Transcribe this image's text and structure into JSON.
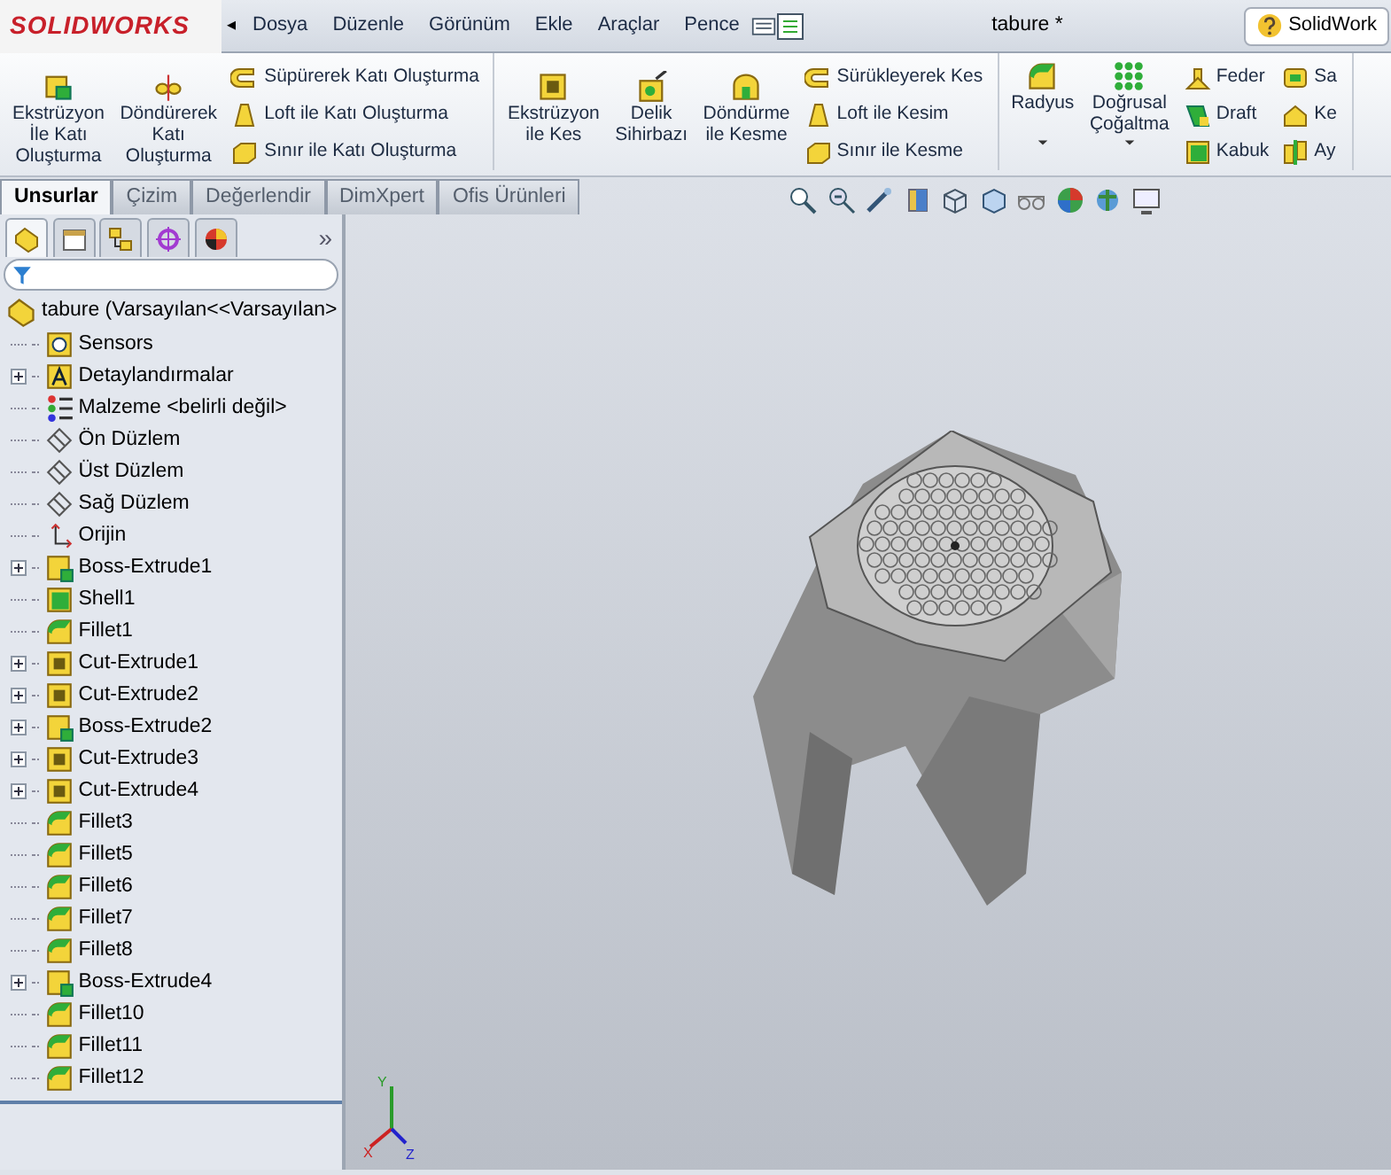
{
  "title_bar": {
    "logo": "SOLIDWORKS",
    "collapse_arrow": "◂",
    "menu": [
      "Dosya",
      "Düzenle",
      "Görünüm",
      "Ekle",
      "Araçlar",
      "Pence"
    ],
    "document_title": "tabure *",
    "help_search": "SolidWork"
  },
  "ribbon": {
    "groups": [
      {
        "items": [
          {
            "kind": "large",
            "label": "Ekstrüzyon\nİle Katı\nOluşturma"
          },
          {
            "kind": "large",
            "label": "Döndürerek\nKatı\nOluşturma"
          },
          {
            "kind": "stack",
            "buttons": [
              {
                "label": "Süpürerek Katı Oluşturma"
              },
              {
                "label": "Loft ile Katı Oluşturma"
              },
              {
                "label": "Sınır ile Katı Oluşturma"
              }
            ]
          }
        ]
      },
      {
        "items": [
          {
            "kind": "large",
            "label": "Ekstrüzyon\nile Kes"
          },
          {
            "kind": "large",
            "label": "Delik\nSihirbazı"
          },
          {
            "kind": "large",
            "label": "Döndürme\nile Kesme"
          },
          {
            "kind": "stack",
            "buttons": [
              {
                "label": "Sürükleyerek Kes"
              },
              {
                "label": "Loft ile Kesim"
              },
              {
                "label": "Sınır ile Kesme"
              }
            ]
          }
        ]
      },
      {
        "items": [
          {
            "kind": "dropdown",
            "label": "Radyus"
          },
          {
            "kind": "dropdown",
            "label": "Doğrusal\nÇoğaltma"
          },
          {
            "kind": "stack",
            "buttons": [
              {
                "label": "Feder"
              },
              {
                "label": "Draft"
              },
              {
                "label": "Kabuk"
              }
            ]
          },
          {
            "kind": "stack",
            "buttons": [
              {
                "label": "Sa"
              },
              {
                "label": "Ke"
              },
              {
                "label": "Ay"
              }
            ]
          }
        ]
      }
    ]
  },
  "command_tabs": [
    {
      "label": "Unsurlar",
      "selected": true
    },
    {
      "label": "Çizim",
      "selected": false
    },
    {
      "label": "Değerlendir",
      "selected": false
    },
    {
      "label": "DimXpert",
      "selected": false
    },
    {
      "label": "Ofis Ürünleri",
      "selected": false
    }
  ],
  "panel_tabs": [
    {
      "selected": true
    },
    {
      "selected": false
    },
    {
      "selected": false
    },
    {
      "selected": false
    },
    {
      "selected": false
    }
  ],
  "panel_more": "»",
  "feature_tree": {
    "root": {
      "label": "tabure  (Varsayılan<<Varsayılan>",
      "kind": "part"
    },
    "items": [
      {
        "label": "Sensors",
        "kind": "sensors",
        "expandable": false
      },
      {
        "label": "Detaylandırmalar",
        "kind": "annotations",
        "expandable": true
      },
      {
        "label": "Malzeme <belirli değil>",
        "kind": "material",
        "expandable": false
      },
      {
        "label": "Ön Düzlem",
        "kind": "plane",
        "expandable": false
      },
      {
        "label": "Üst Düzlem",
        "kind": "plane",
        "expandable": false
      },
      {
        "label": "Sağ Düzlem",
        "kind": "plane",
        "expandable": false
      },
      {
        "label": "Orijin",
        "kind": "origin",
        "expandable": false
      },
      {
        "label": "Boss-Extrude1",
        "kind": "boss",
        "expandable": true
      },
      {
        "label": "Shell1",
        "kind": "shell",
        "expandable": false
      },
      {
        "label": "Fillet1",
        "kind": "fillet",
        "expandable": false
      },
      {
        "label": "Cut-Extrude1",
        "kind": "cut",
        "expandable": true
      },
      {
        "label": "Cut-Extrude2",
        "kind": "cut",
        "expandable": true
      },
      {
        "label": "Boss-Extrude2",
        "kind": "boss",
        "expandable": true
      },
      {
        "label": "Cut-Extrude3",
        "kind": "cut",
        "expandable": true
      },
      {
        "label": "Cut-Extrude4",
        "kind": "cut",
        "expandable": true
      },
      {
        "label": "Fillet3",
        "kind": "fillet",
        "expandable": false
      },
      {
        "label": "Fillet5",
        "kind": "fillet",
        "expandable": false
      },
      {
        "label": "Fillet6",
        "kind": "fillet",
        "expandable": false
      },
      {
        "label": "Fillet7",
        "kind": "fillet",
        "expandable": false
      },
      {
        "label": "Fillet8",
        "kind": "fillet",
        "expandable": false
      },
      {
        "label": "Boss-Extrude4",
        "kind": "boss",
        "expandable": true
      },
      {
        "label": "Fillet10",
        "kind": "fillet",
        "expandable": false
      },
      {
        "label": "Fillet11",
        "kind": "fillet",
        "expandable": false
      },
      {
        "label": "Fillet12",
        "kind": "fillet",
        "expandable": false
      }
    ]
  },
  "triad": {
    "x": "X",
    "y": "Y",
    "z": "Z"
  }
}
